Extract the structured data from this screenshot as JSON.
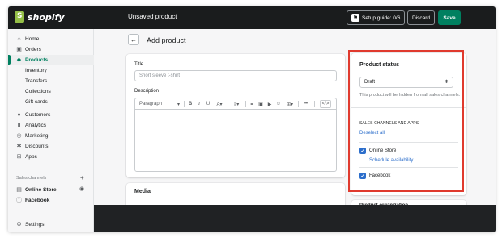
{
  "topbar": {
    "brand": "shopify",
    "page_status": "Unsaved product",
    "setup_guide": "Setup guide: 0/6",
    "discard": "Discard",
    "save": "Save"
  },
  "sidebar": {
    "items": [
      {
        "label": "Home",
        "icon": "home-icon"
      },
      {
        "label": "Orders",
        "icon": "orders-icon"
      },
      {
        "label": "Products",
        "icon": "products-icon"
      },
      {
        "label": "Inventory"
      },
      {
        "label": "Transfers"
      },
      {
        "label": "Collections"
      },
      {
        "label": "Gift cards"
      },
      {
        "label": "Customers",
        "icon": "customers-icon"
      },
      {
        "label": "Analytics",
        "icon": "analytics-icon"
      },
      {
        "label": "Marketing",
        "icon": "marketing-icon"
      },
      {
        "label": "Discounts",
        "icon": "discounts-icon"
      },
      {
        "label": "Apps",
        "icon": "apps-icon"
      }
    ],
    "sales_channels_label": "Sales channels",
    "channels": [
      {
        "label": "Online Store"
      },
      {
        "label": "Facebook"
      }
    ],
    "settings": "Settings"
  },
  "main": {
    "title": "Add product",
    "title_field_label": "Title",
    "title_placeholder": "Short sleeve t-shirt",
    "description_label": "Description",
    "paragraph_select": "Paragraph",
    "media_title": "Media"
  },
  "status_card": {
    "title": "Product status",
    "status_value": "Draft",
    "help": "This product will be hidden from all sales channels.",
    "channels_heading": "SALES CHANNELS AND APPS",
    "deselect_all": "Deselect all",
    "online_store": "Online Store",
    "schedule": "Schedule availability",
    "facebook": "Facebook"
  },
  "organization_card": {
    "title": "Product organization"
  },
  "colors": {
    "accent": "#008060",
    "link": "#2c6ecb",
    "highlight": "#e03a2e",
    "topbar": "#1a1c1d"
  }
}
